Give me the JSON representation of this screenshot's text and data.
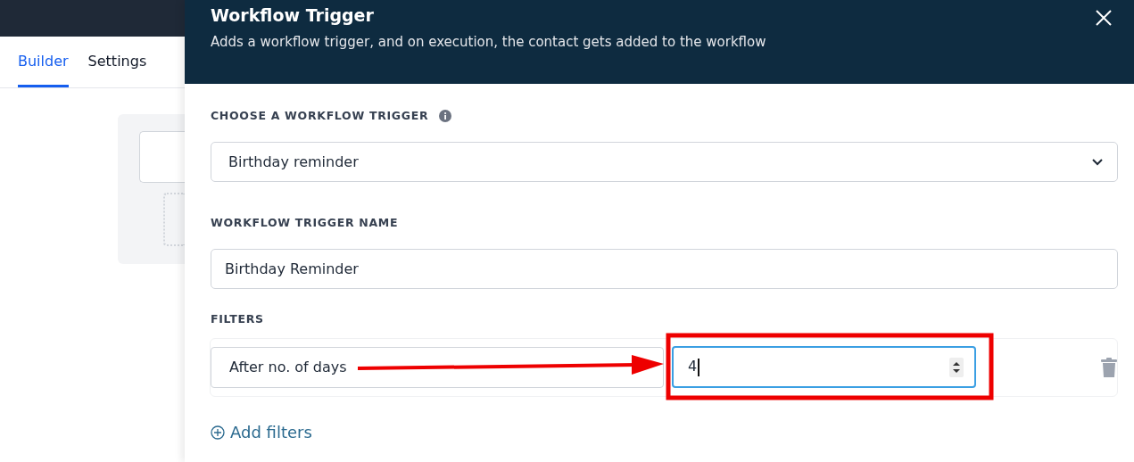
{
  "tabs": [
    {
      "label": "Builder",
      "selected": true
    },
    {
      "label": "Settings",
      "selected": false
    }
  ],
  "drawer": {
    "title": "Workflow Trigger",
    "subtitle": "Adds a workflow trigger, and on execution, the contact gets added to the workflow",
    "trigger": {
      "label": "CHOOSE A WORKFLOW TRIGGER",
      "value": "Birthday reminder"
    },
    "name": {
      "label": "WORKFLOW TRIGGER NAME",
      "value": "Birthday Reminder"
    },
    "filters": {
      "label": "FILTERS",
      "items": [
        {
          "field": "After no. of days",
          "value": "4",
          "focused": true
        }
      ]
    },
    "add_filters": "Add filters"
  }
}
